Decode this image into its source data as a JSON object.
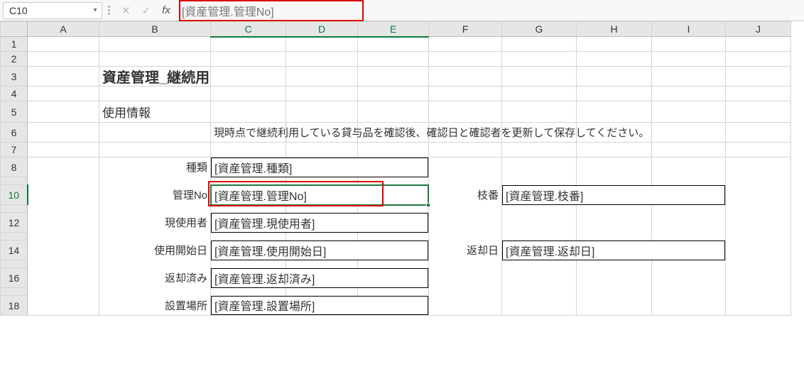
{
  "nameBox": "C10",
  "formulaBar": "[資産管理.管理No]",
  "columns": [
    "A",
    "B",
    "C",
    "D",
    "E",
    "F",
    "G",
    "H",
    "I",
    "J"
  ],
  "rows": [
    "1",
    "2",
    "3",
    "4",
    "5",
    "6",
    "7",
    "8",
    "10",
    "12",
    "14",
    "16",
    "18"
  ],
  "selectedRow": "10",
  "selectedCols": [
    "C",
    "D",
    "E"
  ],
  "cells": {
    "title": "資産管理_継続用",
    "subtitle": "使用情報",
    "instruction": "現時点で継続利用している貸与品を確認後、確認日と確認者を更新して保存してください。",
    "label_type": "種類",
    "val_type": "[資産管理.種類]",
    "label_mgmtNo": "管理No",
    "val_mgmtNo": "[資産管理.管理No]",
    "label_sub": "枝番",
    "val_sub": "[資産管理.枝番]",
    "label_user": "現使用者",
    "val_user": "[資産管理.現使用者]",
    "label_start": "使用開始日",
    "val_start": "[資産管理.使用開始日]",
    "label_return": "返却日",
    "val_return": "[資産管理.返却日]",
    "label_returned": "返却済み",
    "val_returned": "[資産管理.返却済み]",
    "label_location": "設置場所",
    "val_location": "[資産管理.設置場所]"
  }
}
